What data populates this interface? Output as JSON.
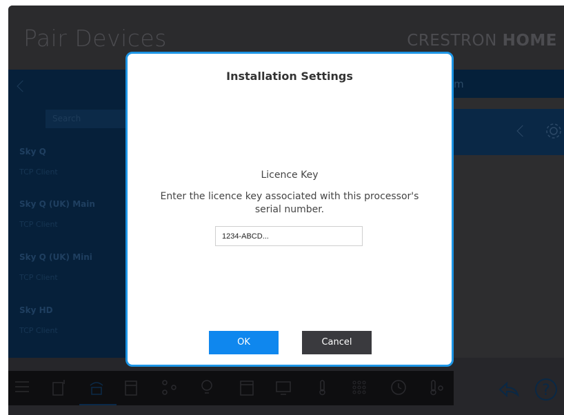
{
  "header": {
    "title": "Pair Devices",
    "brand_light": "CRESTRON",
    "brand_bold": "HOME"
  },
  "left_panel": {
    "search_placeholder": "Search",
    "devices": [
      {
        "name": "Sky Q",
        "type": "TCP Client"
      },
      {
        "name": "Sky Q (UK) Main",
        "type": "TCP Client"
      },
      {
        "name": "Sky Q (UK) Mini",
        "type": "TCP Client"
      },
      {
        "name": "Sky HD",
        "type": "TCP Client"
      }
    ]
  },
  "right_strip_text": "m",
  "dialog": {
    "title": "Installation Settings",
    "licence_label": "Licence Key",
    "licence_description": "Enter the licence key associated with this processor's serial number.",
    "licence_value": "1234-ABCD...",
    "ok_label": "OK",
    "cancel_label": "Cancel"
  },
  "toolbar_icons": [
    "menu-icon",
    "room-add-icon",
    "remote-icon",
    "window-shades-icon",
    "nodes-icon",
    "lightbulb-icon",
    "panel-icon",
    "display-icon",
    "thermometer-icon",
    "keypad-icon",
    "clock-icon",
    "temperature-sensor-icon",
    "share-icon",
    "help-icon"
  ],
  "colors": {
    "accent": "#1d95e5",
    "ok_button": "#0f87ee",
    "cancel_button": "#3a3a3e",
    "panel_blue": "#06203a"
  }
}
